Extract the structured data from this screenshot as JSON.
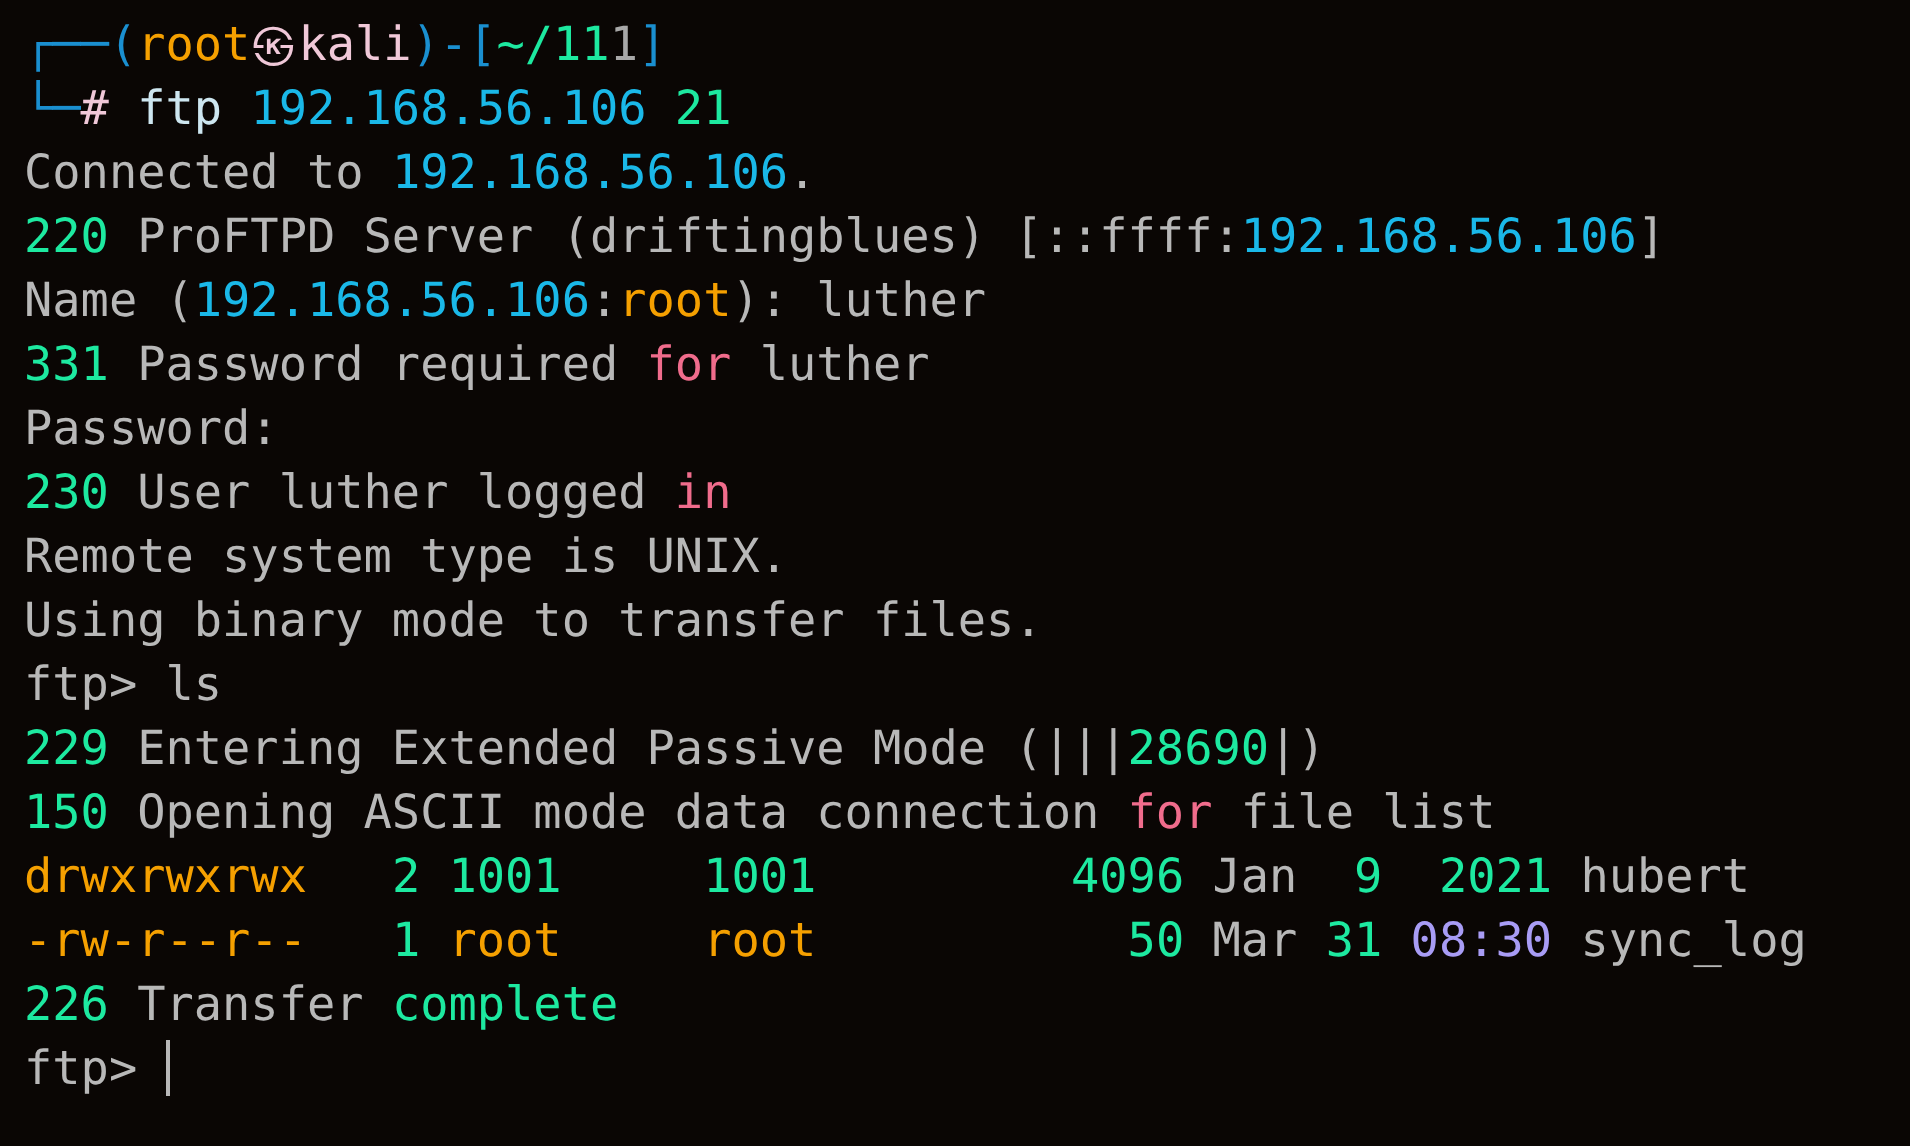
{
  "terminal": {
    "lines": [
      {
        "segments": [
          {
            "text": "┌──(",
            "color": "#1a8fd0"
          },
          {
            "text": "root",
            "color": "#f5a000"
          },
          {
            "text": "㉿",
            "color": "#f0c8d8"
          },
          {
            "text": "kali",
            "color": "#f0c8d8"
          },
          {
            "text": ")-[",
            "color": "#1a8fd0"
          },
          {
            "text": "~/11",
            "color": "#1de9a0"
          },
          {
            "text": "1",
            "color": "#a8a8a8"
          },
          {
            "text": "]",
            "color": "#1a8fd0"
          }
        ]
      },
      {
        "segments": [
          {
            "text": "└─",
            "color": "#1a8fd0"
          },
          {
            "text": "# ",
            "color": "#f0c8d8"
          },
          {
            "text": "ftp ",
            "color": "#cde6f0"
          },
          {
            "text": "192.168.56.106 ",
            "color": "#1ab8e8"
          },
          {
            "text": "21",
            "color": "#1de9a0"
          }
        ]
      },
      {
        "segments": [
          {
            "text": "Connected to ",
            "color": "#b8b8b8"
          },
          {
            "text": "192.168.56.106",
            "color": "#1ab8e8"
          },
          {
            "text": ".",
            "color": "#b8b8b8"
          }
        ]
      },
      {
        "segments": [
          {
            "text": "220 ",
            "color": "#1de9a0"
          },
          {
            "text": "ProFTPD Server (driftingblues) [::ffff:",
            "color": "#b8b8b8"
          },
          {
            "text": "192.168.56.106",
            "color": "#1ab8e8"
          },
          {
            "text": "]",
            "color": "#b8b8b8"
          }
        ]
      },
      {
        "segments": [
          {
            "text": "Name (",
            "color": "#b8b8b8"
          },
          {
            "text": "192.168.56.106",
            "color": "#1ab8e8"
          },
          {
            "text": ":",
            "color": "#b8b8b8"
          },
          {
            "text": "root",
            "color": "#f5a000"
          },
          {
            "text": "): luther",
            "color": "#b8b8b8"
          }
        ]
      },
      {
        "segments": [
          {
            "text": "331 ",
            "color": "#1de9a0"
          },
          {
            "text": "Password required ",
            "color": "#b8b8b8"
          },
          {
            "text": "for",
            "color": "#f06c8c"
          },
          {
            "text": " luther",
            "color": "#b8b8b8"
          }
        ]
      },
      {
        "segments": [
          {
            "text": "Password:",
            "color": "#b8b8b8"
          }
        ]
      },
      {
        "segments": [
          {
            "text": "230 ",
            "color": "#1de9a0"
          },
          {
            "text": "User luther logged ",
            "color": "#b8b8b8"
          },
          {
            "text": "in",
            "color": "#f06c8c"
          }
        ]
      },
      {
        "segments": [
          {
            "text": "Remote system type is UNIX.",
            "color": "#b8b8b8"
          }
        ]
      },
      {
        "segments": [
          {
            "text": "Using binary mode to transfer files.",
            "color": "#b8b8b8"
          }
        ]
      },
      {
        "segments": [
          {
            "text": "ftp> ls",
            "color": "#b8b8b8"
          }
        ]
      },
      {
        "segments": [
          {
            "text": "229 ",
            "color": "#1de9a0"
          },
          {
            "text": "Entering Extended Passive Mode (|||",
            "color": "#b8b8b8"
          },
          {
            "text": "28690",
            "color": "#1de9a0"
          },
          {
            "text": "|)",
            "color": "#b8b8b8"
          }
        ]
      },
      {
        "segments": [
          {
            "text": "150 ",
            "color": "#1de9a0"
          },
          {
            "text": "Opening ASCII mode data connection ",
            "color": "#b8b8b8"
          },
          {
            "text": "for",
            "color": "#f06c8c"
          },
          {
            "text": " file list",
            "color": "#b8b8b8"
          }
        ]
      },
      {
        "segments": [
          {
            "text": "drwxrwxrwx   ",
            "color": "#f5a000"
          },
          {
            "text": "2 1001     1001         4096 ",
            "color": "#1de9a0"
          },
          {
            "text": "Jan  ",
            "color": "#b8b8b8"
          },
          {
            "text": "9  2021 ",
            "color": "#1de9a0"
          },
          {
            "text": "hubert",
            "color": "#b8b8b8"
          }
        ]
      },
      {
        "segments": [
          {
            "text": "-rw-r--r--   ",
            "color": "#f5a000"
          },
          {
            "text": "1 ",
            "color": "#1de9a0"
          },
          {
            "text": "root     root           ",
            "color": "#f5a000"
          },
          {
            "text": "50 ",
            "color": "#1de9a0"
          },
          {
            "text": "Mar ",
            "color": "#b8b8b8"
          },
          {
            "text": "31 ",
            "color": "#1de9a0"
          },
          {
            "text": "08:30 ",
            "color": "#a89cf5"
          },
          {
            "text": "sync_log",
            "color": "#b8b8b8"
          }
        ]
      },
      {
        "segments": [
          {
            "text": "226 ",
            "color": "#1de9a0"
          },
          {
            "text": "Transfer ",
            "color": "#b8b8b8"
          },
          {
            "text": "complete",
            "color": "#1de9a0"
          }
        ]
      }
    ],
    "prompt": {
      "text": "ftp> ",
      "color": "#b8b8b8"
    }
  }
}
